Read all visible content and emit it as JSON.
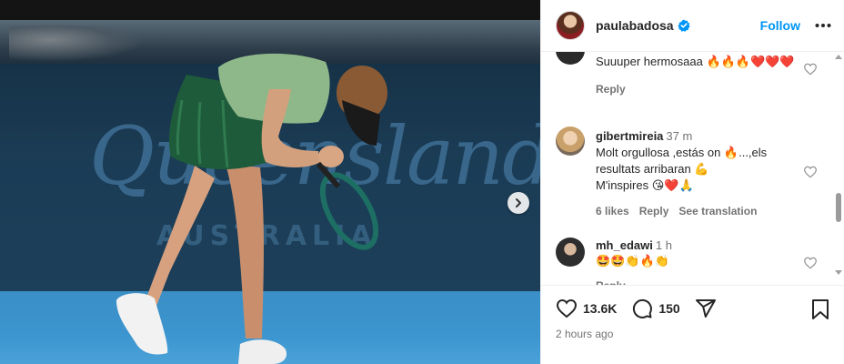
{
  "media": {
    "banner_text": "Queensland",
    "banner_subtext": "AUSTRALIA"
  },
  "header": {
    "username": "paulabadosa",
    "follow_label": "Follow"
  },
  "comments": [
    {
      "text": "Suuuper hermosaaa",
      "emojis": "🔥🔥🔥❤️❤️❤️",
      "reply_label": "Reply"
    },
    {
      "username": "gibertmireia",
      "time": "37 m",
      "line1": "Molt orgullosa ,estás on 🔥...,els",
      "line2": "resultats arribaran 💪",
      "line3": "M'inspires 😘❤️🙏",
      "likes": "6 likes",
      "reply_label": "Reply",
      "translate_label": "See translation"
    },
    {
      "username": "mh_edawi",
      "time": "1 h",
      "emojis": "🤩🤩👏🔥👏",
      "reply_label": "Reply"
    }
  ],
  "actions": {
    "likes_count": "13.6K",
    "comments_count": "150",
    "time_ago": "2 hours ago"
  },
  "colors": {
    "accent": "#0095f6",
    "text": "#262626",
    "muted": "#737373"
  }
}
